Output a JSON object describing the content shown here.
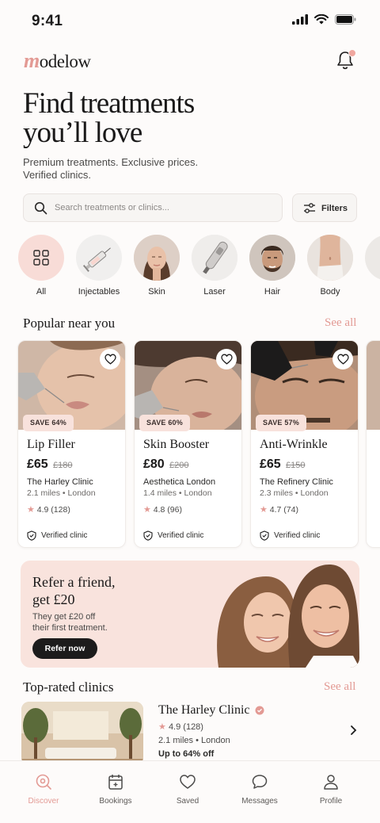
{
  "status_bar": {
    "time": "9:41"
  },
  "header": {
    "logo_mark": "m",
    "logo_rest": "odelow"
  },
  "hero": {
    "title_line1": "Find treatments",
    "title_line2": "you’ll love",
    "subtitle_line1": "Premium treatments. Exclusive prices.",
    "subtitle_line2": "Verified clinics."
  },
  "search": {
    "placeholder": "Search treatments or clinics...",
    "filters_label": "Filters"
  },
  "categories": [
    {
      "label": "All",
      "icon": "grid-icon"
    },
    {
      "label": "Injectables",
      "icon": "syringe-icon"
    },
    {
      "label": "Skin",
      "icon": "face-photo"
    },
    {
      "label": "Laser",
      "icon": "laser-device-photo"
    },
    {
      "label": "Hair",
      "icon": "man-face-photo"
    },
    {
      "label": "Body",
      "icon": "body-photo"
    }
  ],
  "popular": {
    "title": "Popular near you",
    "see_all": "See all",
    "cards": [
      {
        "save": "SAVE 64%",
        "name": "Lip Filler",
        "price": "£65",
        "old_price": "£180",
        "clinic": "The Harley Clinic",
        "distance": "2.1 miles • London",
        "rating": "4.9 (128)",
        "verified": "Verified clinic"
      },
      {
        "save": "SAVE 60%",
        "name": "Skin Booster",
        "price": "£80",
        "old_price": "£200",
        "clinic": "Aesthetica London",
        "distance": "1.4 miles • London",
        "rating": "4.8 (96)",
        "verified": "Verified clinic"
      },
      {
        "save": "SAVE 57%",
        "name": "Anti-Wrinkle",
        "price": "£65",
        "old_price": "£150",
        "clinic": "The Refinery Clinic",
        "distance": "2.3 miles • London",
        "rating": "4.7 (74)",
        "verified": "Verified clinic"
      }
    ]
  },
  "refer": {
    "title_line1": "Refer a friend,",
    "title_line2": "get £20",
    "sub_line1": "They get £20 off",
    "sub_line2": "their first treatment.",
    "button": "Refer now"
  },
  "top_rated": {
    "title": "Top-rated clinics",
    "see_all": "See all",
    "clinic": {
      "name": "The Harley Clinic",
      "rating": "4.9 (128)",
      "distance": "2.1 miles • London",
      "deal": "Up to 64% off"
    }
  },
  "nav": [
    {
      "label": "Discover",
      "active": true
    },
    {
      "label": "Bookings",
      "active": false
    },
    {
      "label": "Saved",
      "active": false
    },
    {
      "label": "Messages",
      "active": false
    },
    {
      "label": "Profile",
      "active": false
    }
  ],
  "colors": {
    "accent": "#e39a94",
    "accent_bg": "#f9e3dd",
    "dark": "#1c1b1b"
  }
}
